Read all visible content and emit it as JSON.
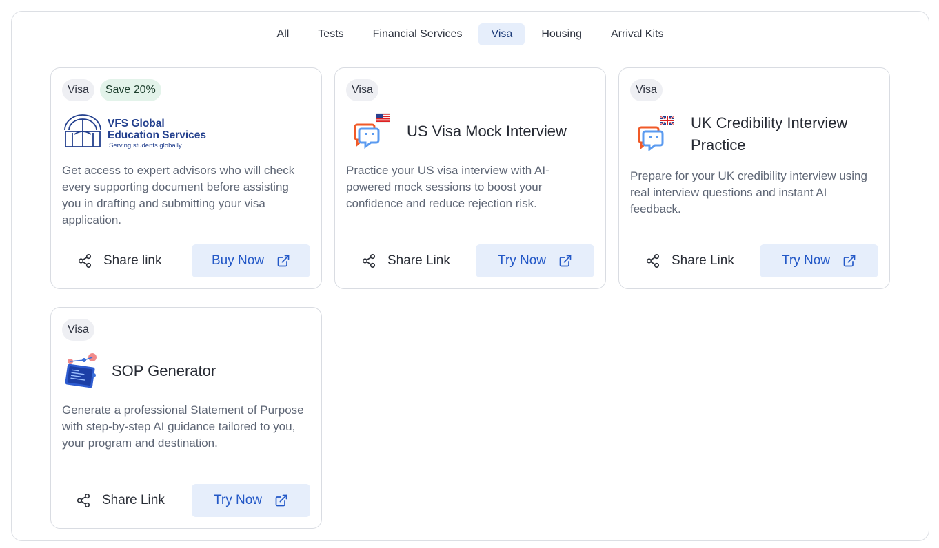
{
  "tabs": [
    {
      "label": "All",
      "active": false
    },
    {
      "label": "Tests",
      "active": false
    },
    {
      "label": "Financial Services",
      "active": false
    },
    {
      "label": "Visa",
      "active": true
    },
    {
      "label": "Housing",
      "active": false
    },
    {
      "label": "Arrival Kits",
      "active": false
    }
  ],
  "cards": [
    {
      "badges": [
        "Visa",
        "Save 20%"
      ],
      "logo": {
        "line1": "VFS Global",
        "line2": "Education Services",
        "tagline": "Serving students globally"
      },
      "description": "Get access to expert advisors who will check every supporting document before assisting you in drafting and submitting your visa application.",
      "share_label": "Share link",
      "action_label": "Buy Now"
    },
    {
      "badges": [
        "Visa"
      ],
      "icon": "chat-bot-us-flag-icon",
      "title": "US Visa Mock Interview",
      "description": "Practice your US visa interview with AI-powered mock sessions to boost your confidence and reduce rejection risk.",
      "share_label": "Share Link",
      "action_label": "Try Now"
    },
    {
      "badges": [
        "Visa"
      ],
      "icon": "chat-bot-uk-flag-icon",
      "title": "UK Credibility Interview Practice",
      "description": "Prepare for your UK credibility interview using real interview questions and instant AI feedback.",
      "share_label": "Share Link",
      "action_label": "Try Now"
    },
    {
      "badges": [
        "Visa"
      ],
      "icon": "document-generator-icon",
      "title": "SOP Generator",
      "description": "Generate a professional Statement of Purpose with step-by-step AI guidance tailored to you, your program and destination.",
      "share_label": "Share Link",
      "action_label": "Try Now"
    }
  ],
  "colors": {
    "accent": "#2358c7",
    "accent_bg": "#e6eefb",
    "badge_bg": "#eeeff3",
    "save_bg": "#e3f3ea",
    "brand_orange": "#f05a28",
    "brand_blue": "#3b82f6"
  }
}
